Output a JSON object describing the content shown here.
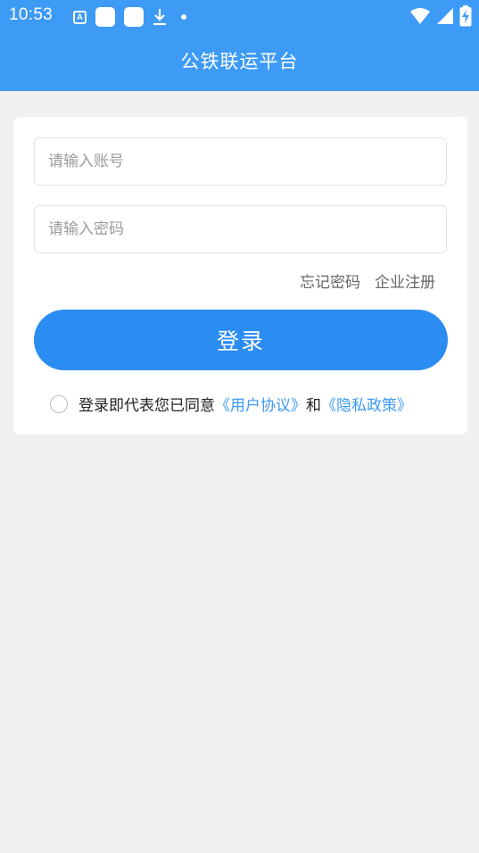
{
  "status_bar": {
    "time": "10:53"
  },
  "app_bar": {
    "title": "公铁联运平台"
  },
  "login_form": {
    "account": {
      "placeholder": "请输入账号",
      "value": ""
    },
    "password": {
      "placeholder": "请输入密码",
      "value": ""
    },
    "forgot_password_label": "忘记密码",
    "company_register_label": "企业注册",
    "login_button_label": "登录",
    "agreement": {
      "prefix": "登录即代表您已同意",
      "user_agreement_link": "《用户协议》",
      "and": "和",
      "privacy_policy_link": "《隐私政策》",
      "checked": false
    }
  },
  "colors": {
    "primary": "#3d9af5",
    "button": "#2b8df2",
    "background": "#f0f0f0",
    "card": "#ffffff",
    "link": "#3d9af5"
  },
  "icons": [
    "notification-a-icon",
    "app-notification-icon",
    "app-notification-icon",
    "download-icon",
    "dot-icon",
    "wifi-icon",
    "cell-signal-icon",
    "battery-charging-icon"
  ]
}
